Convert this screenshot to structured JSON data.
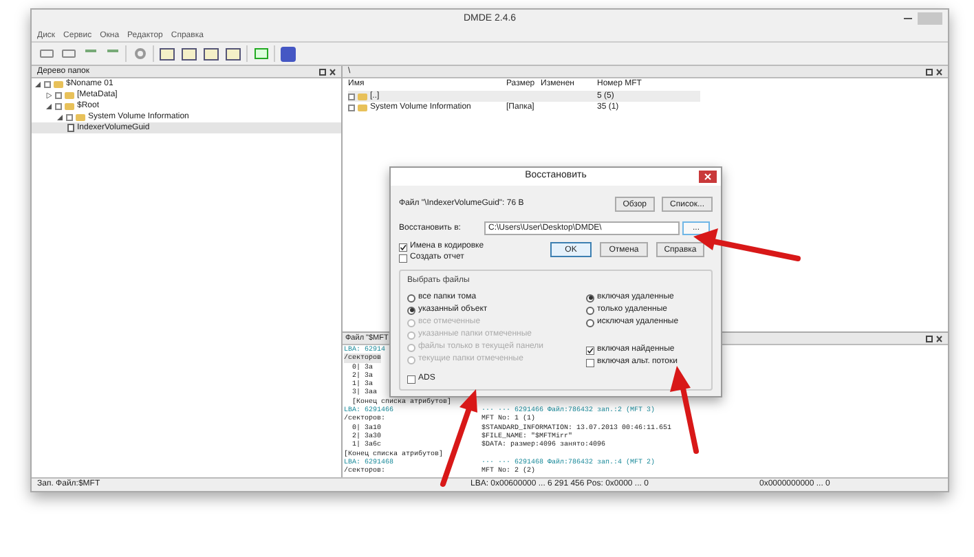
{
  "window": {
    "title": "DMDE 2.4.6"
  },
  "menu": [
    "Диск",
    "Сервис",
    "Окна",
    "Редактор",
    "Справка"
  ],
  "folder_tree": {
    "title": "Дерево папок",
    "items": [
      {
        "label": "$Noname 01",
        "expanded": true,
        "selected": false,
        "children": [
          {
            "label": "[MetaData]",
            "expanded": false,
            "selected": false
          },
          {
            "label": "$Root",
            "expanded": true,
            "selected": false,
            "children": [
              {
                "label": "System Volume Information",
                "expanded": true,
                "selected": false,
                "children": [
                  {
                    "label": "IndexerVolumeGuid",
                    "kind": "file",
                    "selected": true
                  }
                ]
              }
            ]
          }
        ]
      }
    ]
  },
  "file_list": {
    "title": "\\",
    "columns": [
      "Имя",
      "Размер",
      "Изменен",
      "Номер MFT"
    ],
    "rows": [
      {
        "cells": [
          "[..]",
          "",
          "",
          "5 (5)"
        ],
        "selected": true
      },
      {
        "cells": [
          "System Volume Information",
          "[Папка]",
          "",
          "35 (1)"
        ],
        "selected": false
      }
    ]
  },
  "log_panel": {
    "title": "Файл \"$MFT",
    "lines": [
      {
        "kind": "lba",
        "text": "LBA: 62914"
      },
      {
        "kind": "header",
        "text": "/секторов"
      },
      {
        "kind": "text",
        "text": "  0| 3a"
      },
      {
        "kind": "text",
        "text": "  2| 3a"
      },
      {
        "kind": "text",
        "text": "  1| 3a"
      },
      {
        "kind": "text",
        "text": "  3| 3aa"
      },
      {
        "kind": "text",
        "text": "  [Конец списка атрибутов]"
      },
      {
        "kind": "lba",
        "text": "LBA: 6291466",
        "rest": "··· ··· 6291466 Файл:786432 зап.:2 (MFT 3)"
      },
      {
        "kind": "text",
        "text": "/секторов:",
        "rest": "MFT No: 1 (1)"
      },
      {
        "kind": "text",
        "text": "  0| 3a10",
        "rest": "$STANDARD_INFORMATION: 13.07.2013 00:46:11.651"
      },
      {
        "kind": "text",
        "text": "  2| 3a30",
        "rest": "$FILE_NAME: \"$MFTMirr\""
      },
      {
        "kind": "text",
        "text": "  1| 3a6c",
        "rest": "$DATA: размер:4096 занято:4096"
      },
      {
        "kind": "text",
        "text": "[Конец списка атрибутов]"
      },
      {
        "kind": "lba",
        "text": "LBA: 6291468",
        "rest": "··· ··· 6291468 Файл:786432 зап.:4 (MFT 2)"
      },
      {
        "kind": "text",
        "text": "/секторов:",
        "rest": "MFT No: 2 (2)"
      }
    ]
  },
  "status_bar": [
    "Зап. Файл:$MFT",
    "LBA: 0x00600000 ... 6 291 456 Pos: 0x0000 ... 0",
    "0x0000000000 ... 0"
  ],
  "dialog": {
    "title": "Восстановить",
    "file_info": "Файл \"\\IndexerVolumeGuid\": 76 B",
    "browse_buttons": [
      "Обзор",
      "Список..."
    ],
    "target_label": "Восстановить в:",
    "target_value": "C:\\Users\\User\\Desktop\\DMDE\\",
    "target_button": "...",
    "options": [
      {
        "label": "Имена в кодировке",
        "checked": true
      },
      {
        "label": "Создать отчет",
        "checked": false
      }
    ],
    "buttons": [
      "OK",
      "Отмена",
      "Справка"
    ],
    "group": {
      "title": "Выбрать файлы",
      "left_radios": [
        {
          "label": "все папки тома",
          "selected": false,
          "disabled": false
        },
        {
          "label": "указанный объект",
          "selected": true,
          "disabled": false
        },
        {
          "label": "все отмеченные",
          "selected": false,
          "disabled": true
        },
        {
          "label": "указанные папки отмеченные",
          "selected": false,
          "disabled": true
        },
        {
          "label": "файлы только в текущей панели",
          "selected": false,
          "disabled": true
        },
        {
          "label": "текущие папки отмеченные",
          "selected": false,
          "disabled": true
        }
      ],
      "left_checks": [
        {
          "label": "ADS",
          "checked": false
        }
      ],
      "right_radios": [
        {
          "label": "включая удаленные",
          "selected": true
        },
        {
          "label": "только удаленные",
          "selected": false
        },
        {
          "label": "исключая удаленные",
          "selected": false
        }
      ],
      "right_checks": [
        {
          "label": "включая найденные",
          "checked": true
        },
        {
          "label": "включая альт. потоки",
          "checked": false
        }
      ]
    }
  }
}
